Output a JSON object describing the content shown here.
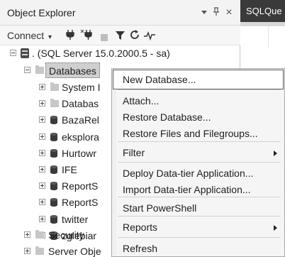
{
  "panel": {
    "title": "Object Explorer",
    "pin_glyph": "▾ ⊥",
    "close_glyph": "×"
  },
  "toolbar": {
    "connect_label": "Connect",
    "connect_arrow": "▾",
    "connect_icon": "plug-icon",
    "disconnect_icon": "plug-x-icon",
    "stop_icon": "stop-icon",
    "filter_icon": "filter-icon",
    "refresh_icon": "refresh-icon",
    "activity_icon": "activity-monitor-icon"
  },
  "tree": {
    "server": ". (SQL Server 15.0.2000.5 - sa)",
    "databases": "Databases",
    "children": [
      {
        "label": "System I",
        "icon": "folder-icon"
      },
      {
        "label": "Databas",
        "icon": "folder-icon"
      },
      {
        "label": "BazaRel",
        "icon": "database-icon"
      },
      {
        "label": "eksplora",
        "icon": "database-icon"
      },
      {
        "label": "Hurtowr",
        "icon": "database-icon"
      },
      {
        "label": "IFE",
        "icon": "database-icon"
      },
      {
        "label": "ReportS",
        "icon": "database-icon"
      },
      {
        "label": "ReportS",
        "icon": "database-icon"
      },
      {
        "label": "twitter",
        "icon": "database-icon"
      },
      {
        "label": "zglebiar",
        "icon": "database-icon"
      }
    ],
    "security": "Security",
    "server_objects": "Server Obje"
  },
  "document": {
    "tab_label": "SQLQue"
  },
  "context_menu": {
    "items": [
      {
        "label": "New Database...",
        "active": true,
        "submenu": false
      },
      {
        "label": "Attach...",
        "submenu": false
      },
      {
        "label": "Restore Database...",
        "submenu": false
      },
      {
        "label": "Restore Files and Filegroups...",
        "submenu": false
      },
      {
        "label": "Filter",
        "submenu": true
      },
      {
        "label": "Deploy Data-tier Application...",
        "submenu": false
      },
      {
        "label": "Import Data-tier Application...",
        "submenu": false
      },
      {
        "label": "Start PowerShell",
        "submenu": false
      },
      {
        "label": "Reports",
        "submenu": true
      },
      {
        "label": "Refresh",
        "submenu": false
      }
    ]
  },
  "colors": {
    "selection": "#cfcfcf",
    "menu_bg": "#f5f5f5",
    "tab_bg": "#3a3a3a"
  }
}
